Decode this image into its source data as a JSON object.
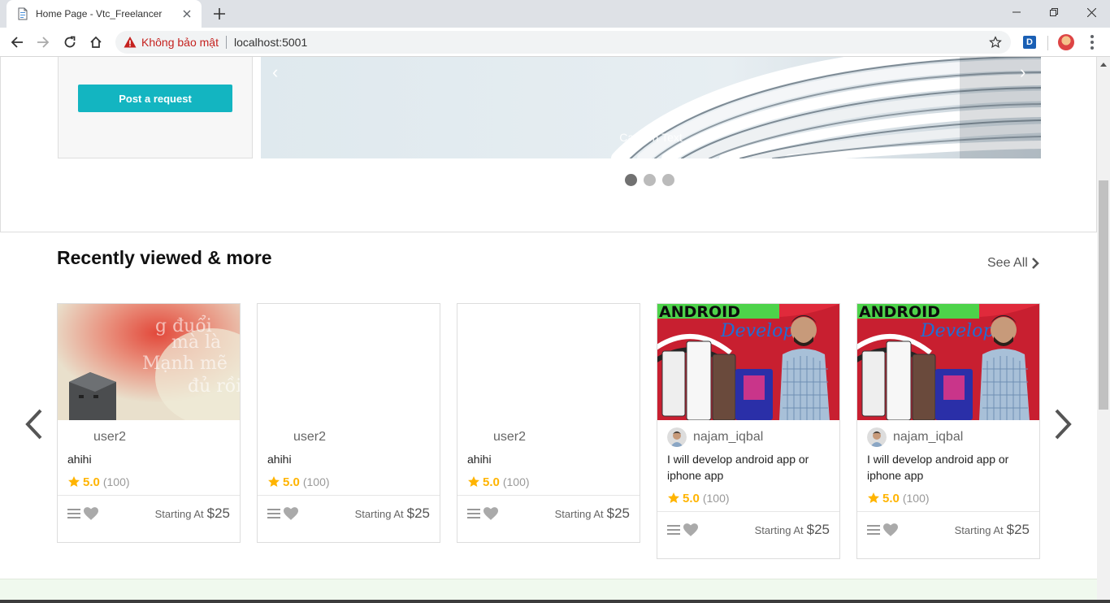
{
  "browser": {
    "tab_title": "Home Page - Vtc_Freelancer",
    "security_label": "Không bảo mật",
    "url": "localhost:5001",
    "extension_letter": "D"
  },
  "hero": {
    "post_button_label": "Post a request",
    "caption": "Caption Text",
    "prev_arrow": "‹",
    "next_arrow": "›",
    "slide_count": 3,
    "active_slide": 1
  },
  "recent": {
    "title": "Recently viewed & more",
    "see_all": "See All",
    "cards": [
      {
        "seller": "user2",
        "title": "ahihi",
        "rating": "5.0",
        "reviews": "(100)",
        "price_label": "Starting At",
        "price": "$25",
        "image": "photo-box",
        "avatar": false
      },
      {
        "seller": "user2",
        "title": "ahihi",
        "rating": "5.0",
        "reviews": "(100)",
        "price_label": "Starting At",
        "price": "$25",
        "image": "none",
        "avatar": false
      },
      {
        "seller": "user2",
        "title": "ahihi",
        "rating": "5.0",
        "reviews": "(100)",
        "price_label": "Starting At",
        "price": "$25",
        "image": "none",
        "avatar": false
      },
      {
        "seller": "najam_iqbal",
        "title": "I will develop android app or iphone app",
        "rating": "5.0",
        "reviews": "(100)",
        "price_label": "Starting At",
        "price": "$25",
        "image": "android-developer",
        "avatar": true
      },
      {
        "seller": "najam_iqbal",
        "title": "I will develop android app or iphone app",
        "rating": "5.0",
        "reviews": "(100)",
        "price_label": "Starting At",
        "price": "$25",
        "image": "android-developer",
        "avatar": true
      }
    ]
  },
  "colors": {
    "accent": "#13b5c1",
    "star": "#ffb400",
    "insecure": "#c5221f"
  }
}
